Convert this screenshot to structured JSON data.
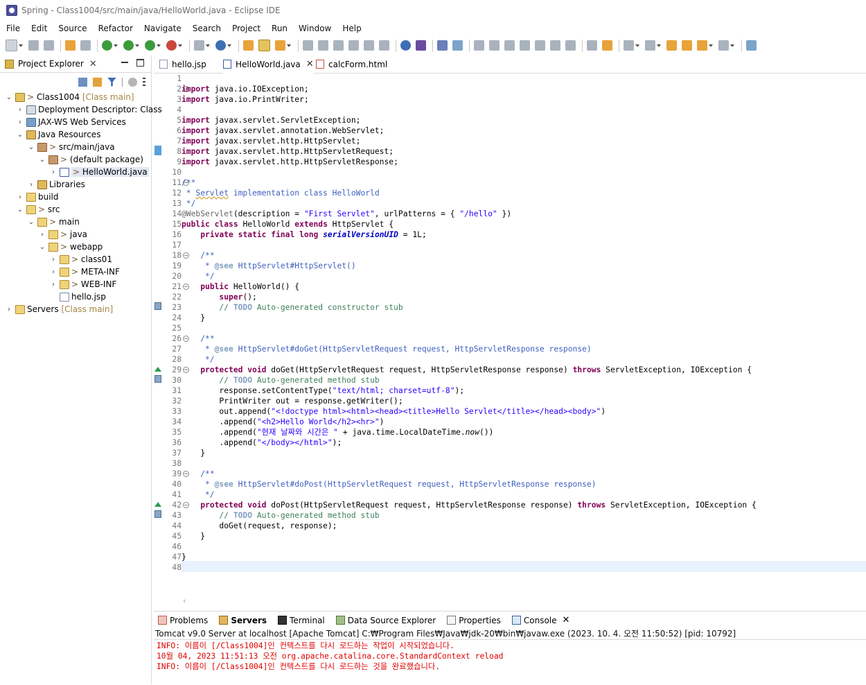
{
  "window": {
    "title": "Spring - Class1004/src/main/java/HelloWorld.java - Eclipse IDE"
  },
  "menu": [
    "File",
    "Edit",
    "Source",
    "Refactor",
    "Navigate",
    "Search",
    "Project",
    "Run",
    "Window",
    "Help"
  ],
  "explorer": {
    "tab_label": "Project Explorer",
    "nodes": [
      {
        "label": "Class1004",
        "deco": ">",
        "suffix": "[Class main]"
      },
      {
        "label": "Deployment Descriptor: Class"
      },
      {
        "label": "JAX-WS Web Services"
      },
      {
        "label": "Java Resources"
      },
      {
        "label": "src/main/java",
        "deco": ">"
      },
      {
        "label": "(default package)",
        "deco": ">"
      },
      {
        "label": "HelloWorld.java",
        "deco": ">"
      },
      {
        "label": "Libraries"
      },
      {
        "label": "build"
      },
      {
        "label": "src",
        "deco": ">"
      },
      {
        "label": "main",
        "deco": ">"
      },
      {
        "label": "java",
        "deco": ">"
      },
      {
        "label": "webapp",
        "deco": ">"
      },
      {
        "label": "class01",
        "deco": ">"
      },
      {
        "label": "META-INF",
        "deco": ">"
      },
      {
        "label": "WEB-INF",
        "deco": ">"
      },
      {
        "label": "hello.jsp"
      },
      {
        "label": "Servers",
        "suffix": "[Class main]"
      }
    ]
  },
  "editor": {
    "tabs": [
      {
        "label": "hello.jsp"
      },
      {
        "label": "HelloWorld.java",
        "active": true
      },
      {
        "label": "calcForm.html"
      }
    ],
    "line_numbers": [
      "1",
      "2",
      "3",
      "4",
      "5",
      "6",
      "7",
      "8",
      "9",
      "10",
      "11",
      "12",
      "13",
      "14",
      "15",
      "16",
      "17",
      "18",
      "19",
      "20",
      "21",
      "22",
      "23",
      "24",
      "25",
      "26",
      "27",
      "28",
      "29",
      "30",
      "31",
      "32",
      "33",
      "34",
      "35",
      "36",
      "37",
      "38",
      "39",
      "40",
      "41",
      "42",
      "43",
      "44",
      "45",
      "46",
      "47",
      "48"
    ]
  },
  "bottom": {
    "tabs": [
      "Problems",
      "Servers",
      "Terminal",
      "Data Source Explorer",
      "Properties",
      "Console"
    ],
    "console_header": "Tomcat v9.0 Server at localhost [Apache Tomcat] C:₩Program Files₩Java₩jdk-20₩bin₩javaw.exe  (2023. 10. 4. 오전 11:50:52) [pid: 10792]",
    "lines": [
      "INFO: 이름이 [/Class1004]인 컨텍스트를 다시 로드하는 작업이 시작되었습니다.",
      "10월 04, 2023 11:51:13 오전 org.apache.catalina.core.StandardContext reload",
      "INFO: 이름이 [/Class1004]인 컨텍스트를 다시 로드하는 것을 완료했습니다."
    ]
  }
}
